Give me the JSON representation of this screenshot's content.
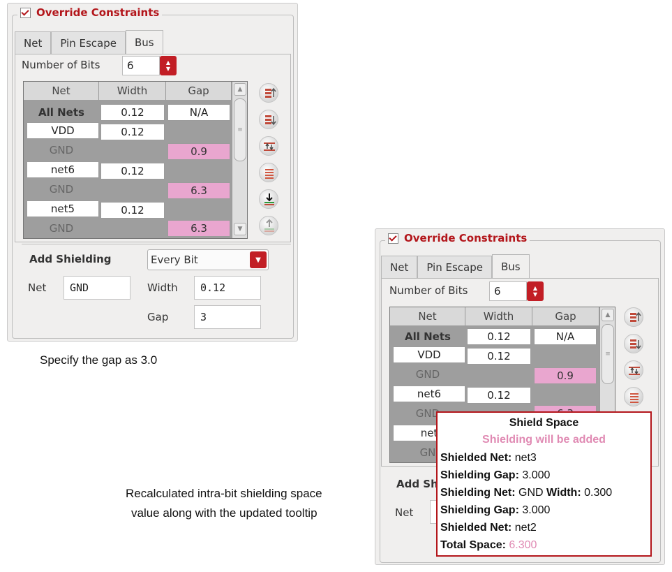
{
  "left_panel": {
    "override_label": "Override Constraints",
    "tabs": [
      "Net",
      "Pin Escape",
      "Bus"
    ],
    "number_of_bits_label": "Number of Bits",
    "number_of_bits_value": "6",
    "table": {
      "headers": [
        "Net",
        "Width",
        "Gap"
      ],
      "rows": [
        {
          "net": "All Nets",
          "width": "0.12",
          "gap": "N/A"
        },
        {
          "net": "VDD",
          "width": "0.12",
          "gap": ""
        },
        {
          "net": "GND",
          "width": "",
          "gap": "0.9"
        },
        {
          "net": "net6",
          "width": "0.12",
          "gap": ""
        },
        {
          "net": "GND",
          "width": "",
          "gap": "6.3"
        },
        {
          "net": "net5",
          "width": "0.12",
          "gap": ""
        },
        {
          "net": "GND",
          "width": "",
          "gap": "6.3"
        }
      ]
    },
    "add_shielding_label": "Add Shielding",
    "add_shielding_value": "Every Bit",
    "net_label": "Net",
    "net_value": "GND",
    "width_label": "Width",
    "width_value": "0.12",
    "gap_label": "Gap",
    "gap_value": "3"
  },
  "caption_left": "Specify the gap as 3.0",
  "caption_right_line1": "Recalculated intra-bit shielding space",
  "caption_right_line2": "value along with the updated tooltip",
  "right_panel": {
    "override_label": "Override Constraints",
    "tabs": [
      "Net",
      "Pin Escape",
      "Bus"
    ],
    "number_of_bits_label": "Number of Bits",
    "number_of_bits_value": "6",
    "table": {
      "headers": [
        "Net",
        "Width",
        "Gap"
      ],
      "rows": [
        {
          "net": "All Nets",
          "width": "0.12",
          "gap": "N/A"
        },
        {
          "net": "VDD",
          "width": "0.12",
          "gap": ""
        },
        {
          "net": "GND",
          "width": "",
          "gap": "0.9"
        },
        {
          "net": "net6",
          "width": "0.12",
          "gap": ""
        },
        {
          "net": "GND",
          "width": "",
          "gap": "6.3"
        },
        {
          "net": "net",
          "width": "",
          "gap": ""
        },
        {
          "net": "GN",
          "width": "",
          "gap": ""
        }
      ]
    },
    "add_shielding_label": "Add Sh",
    "net_label": "Net",
    "net_value": "G"
  },
  "tooltip": {
    "title": "Shield Space",
    "subtitle": "Shielding will be added",
    "lines": [
      {
        "key": "Shielded Net:",
        "value": "net3"
      },
      {
        "key": "Shielding Gap:",
        "value": "3.000"
      },
      {
        "key": "Shielding Net:",
        "value": "GND",
        "key2": "Width:",
        "value2": "0.300"
      },
      {
        "key": "Shielding Gap:",
        "value": "3.000"
      },
      {
        "key": "Shielded Net:",
        "value": "net2"
      },
      {
        "key": "Total Space:",
        "value": "6.300"
      }
    ],
    "colors": {
      "border": "#b3161b",
      "subtitle": "#e08ab3",
      "total": "#e08ab3"
    }
  }
}
